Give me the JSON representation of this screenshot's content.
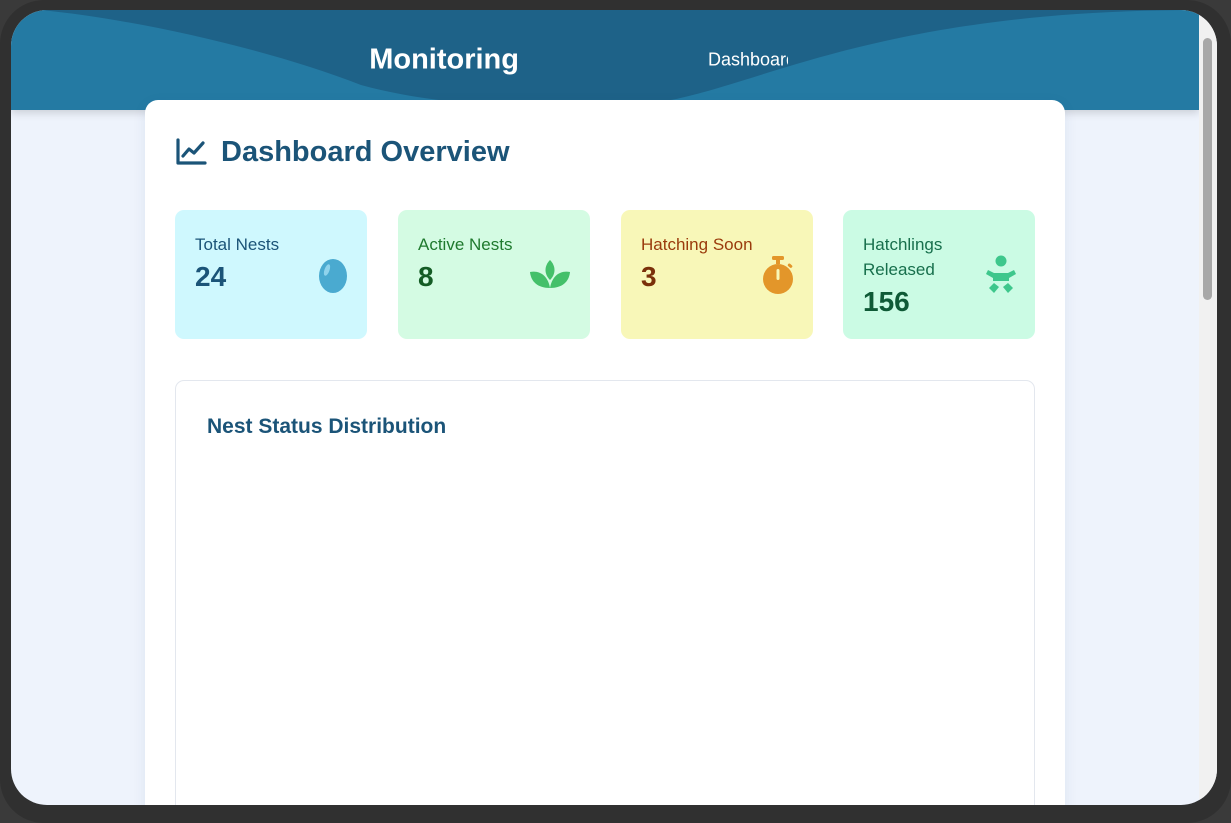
{
  "header": {
    "brand_visible": "Monitoring",
    "nav_link_visible": "Dashboard"
  },
  "main": {
    "title": "Dashboard Overview",
    "title_icon": "line-chart-icon"
  },
  "stats": [
    {
      "label": "Total Nests",
      "value": "24",
      "icon": "egg-icon",
      "bg": "#cff8fe",
      "label_color": "#1b5478",
      "value_color": "#1b5478",
      "icon_color": "#4aaad0"
    },
    {
      "label": "Active Nests",
      "value": "8",
      "icon": "sprout-icon",
      "bg": "#d4fbe3",
      "label_color": "#1f7a2e",
      "value_color": "#145c25",
      "icon_color": "#44c06a"
    },
    {
      "label": "Hatching Soon",
      "value": "3",
      "icon": "stopwatch-icon",
      "bg": "#f8f7b8",
      "label_color": "#9a3b0c",
      "value_color": "#7a300a",
      "icon_color": "#e3962a"
    },
    {
      "label": "Hatchlings Released",
      "value": "156",
      "icon": "baby-icon",
      "bg": "#cbfbe4",
      "label_color": "#176f4c",
      "value_color": "#0f5a36",
      "icon_color": "#3ec78c"
    }
  ],
  "chart_section": {
    "title": "Nest Status Distribution"
  }
}
